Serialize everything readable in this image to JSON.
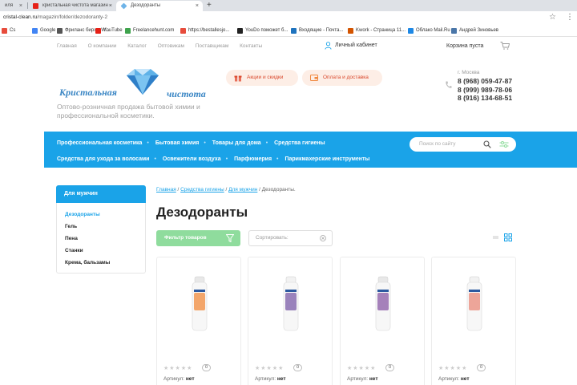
{
  "browser": {
    "tabs": [
      {
        "title": "иля",
        "active": false
      },
      {
        "title": "кристальная чистота магазин -",
        "active": false
      },
      {
        "title": "Дезодоранты",
        "active": true
      }
    ],
    "new_tab": "+",
    "url_host": "cristal-clean.ru",
    "url_path": "/magazin/folder/dezodoranty-2",
    "bookmarks": [
      {
        "label": "Cs",
        "color": "#e74c3c"
      },
      {
        "label": "Google",
        "color": "#4285f4"
      },
      {
        "label": "Фриланс биржа W...",
        "color": "#555555"
      },
      {
        "label": "YouTube",
        "color": "#e62117"
      },
      {
        "label": "Freelancehunt.com",
        "color": "#3fa34d"
      },
      {
        "label": "https://bestallesjo...",
        "color": "#e74c3c"
      },
      {
        "label": "YouDo поможет б...",
        "color": "#222222"
      },
      {
        "label": "Входящие - Почта...",
        "color": "#1e73be"
      },
      {
        "label": "Kwork - Страница 11...",
        "color": "#d35400"
      },
      {
        "label": "Облако Mail.Ru",
        "color": "#1e88e5"
      },
      {
        "label": "Андрей Зиновьев",
        "color": "#4a76a8"
      }
    ]
  },
  "site": {
    "topnav": [
      "Главная",
      "О компании",
      "Каталог",
      "Оптовикам",
      "Поставщикам",
      "Контакты"
    ],
    "cabinet": "Личный кабинет",
    "cart": "Корзина пуста",
    "logo_word1": "Кристальная",
    "logo_word2": "чистота",
    "tagline": "Оптово-розничная продажа бытовой химии и профессиональной косметики.",
    "promo_btn": "Акции и скидки",
    "delivery_btn": "Оплата и доставка",
    "city": "г. Москва",
    "phones": [
      "8 (968) 059-47-87",
      "8 (999) 989-78-06",
      "8 (916) 134-68-51"
    ],
    "colors": {
      "accent": "#1aa3e8",
      "green": "#8fdc9d",
      "promo": "#d9472b"
    }
  },
  "mainnav": {
    "row1": [
      "Профессиональная косметика",
      "Бытовая химия",
      "Товары для дома",
      "Средства гигиены"
    ],
    "row2": [
      "Средства для ухода за волосами",
      "Освежители воздуха",
      "Парфюмерия",
      "Парикмахерские инструменты"
    ],
    "search_placeholder": "Поиск по сайту"
  },
  "sidebar": {
    "title": "Для мужчин",
    "items": [
      "Дезодоранты",
      "Гель",
      "Пена",
      "Станки",
      "Крема, бальзамы"
    ]
  },
  "content": {
    "breadcrumb": [
      "Главная",
      "Средства гигиены",
      "Для мужчин",
      "Дезодоранты."
    ],
    "title": "Дезодоранты",
    "filter_btn": "Фильтр товаров",
    "sort_placeholder": "Сортировать:",
    "products": [
      {
        "rating": 0,
        "rating_count": "0",
        "sku_label": "Артикул:",
        "sku_value": "нет",
        "cap": "#e8e8e8",
        "accent": "#f28b3c"
      },
      {
        "rating": 0,
        "rating_count": "0",
        "sku_label": "Артикул:",
        "sku_value": "нет",
        "cap": "#f2f2f2",
        "accent": "#7b5ca8"
      },
      {
        "rating": 0,
        "rating_count": "0",
        "sku_label": "Артикул:",
        "sku_value": "нет",
        "cap": "#e8e8e8",
        "accent": "#8a5aa6"
      },
      {
        "rating": 0,
        "rating_count": "0",
        "sku_label": "Артикул:",
        "sku_value": "нет",
        "cap": "#f2f2f2",
        "accent": "#e98a7a"
      }
    ]
  }
}
